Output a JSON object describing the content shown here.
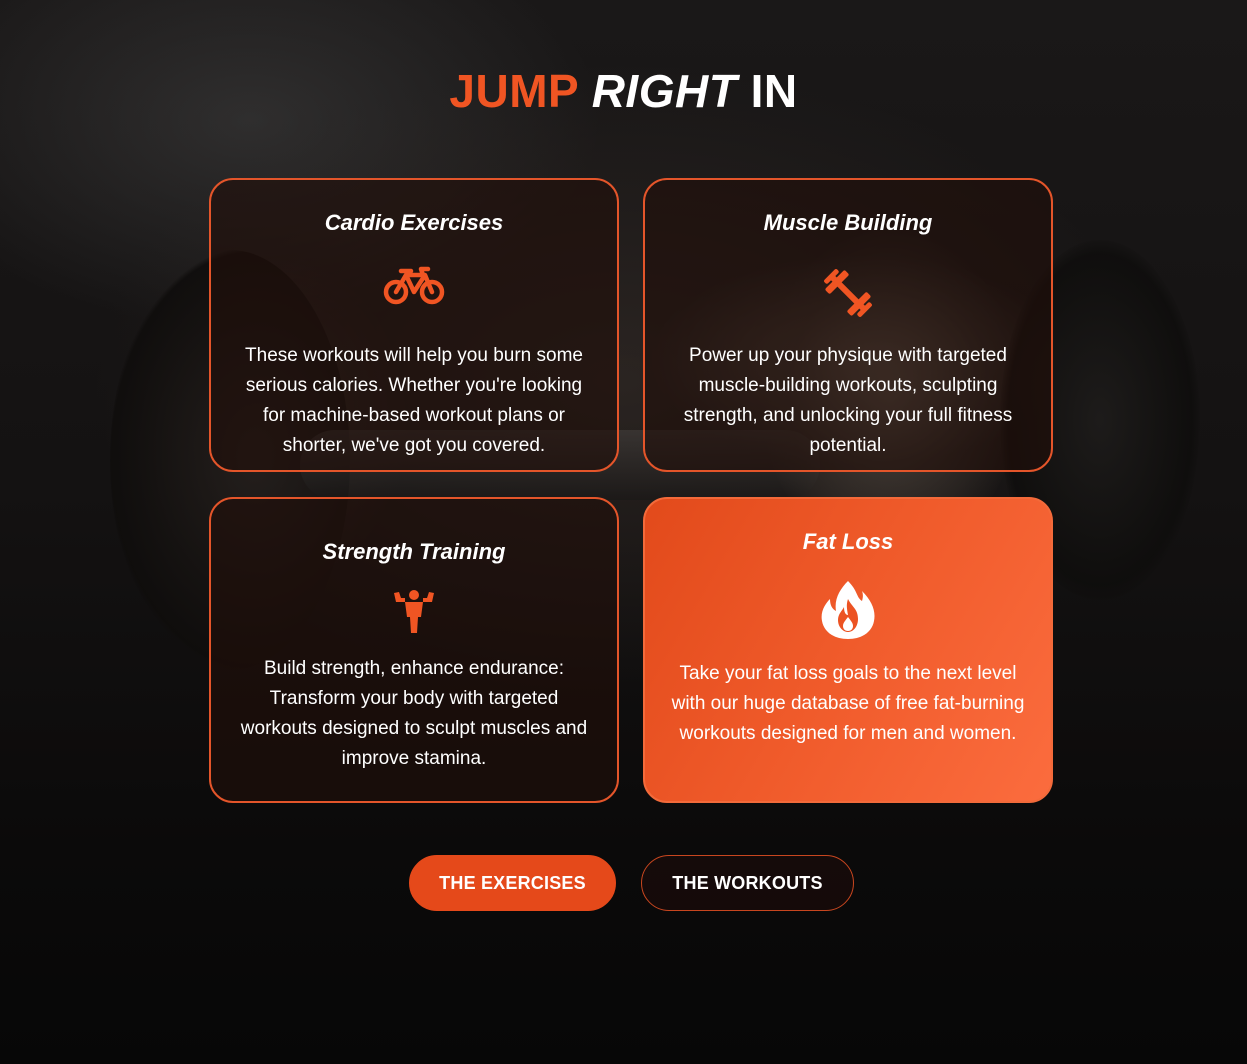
{
  "header": {
    "title_word1": "JUMP",
    "title_word2": "RIGHT",
    "title_word3": "IN"
  },
  "cards": [
    {
      "title": "Cardio Exercises",
      "icon": "bicycle-icon",
      "description": "These workouts will help you burn some serious calories. Whether you're looking for machine-based workout plans or shorter, we've got you covered."
    },
    {
      "title": "Muscle Building",
      "icon": "dumbbell-icon",
      "description": "Power up your physique with targeted muscle-building workouts, sculpting strength, and unlocking your full fitness potential."
    },
    {
      "title": "Strength Training",
      "icon": "flexing-figure-icon",
      "description": "Build strength, enhance endurance: Transform your body with targeted workouts designed to sculpt muscles and improve stamina."
    },
    {
      "title": "Fat Loss",
      "icon": "flame-icon",
      "description": "Take your fat loss goals to the next level with our huge database of free fat-burning workouts designed for men and women."
    }
  ],
  "buttons": {
    "exercises_label": "THE EXERCISES",
    "workouts_label": "THE WORKOUTS"
  },
  "colors": {
    "accent": "#f05523",
    "card_border": "#e4552a",
    "highlight_card": "#f05b2b",
    "background": "#0b0a0a"
  }
}
